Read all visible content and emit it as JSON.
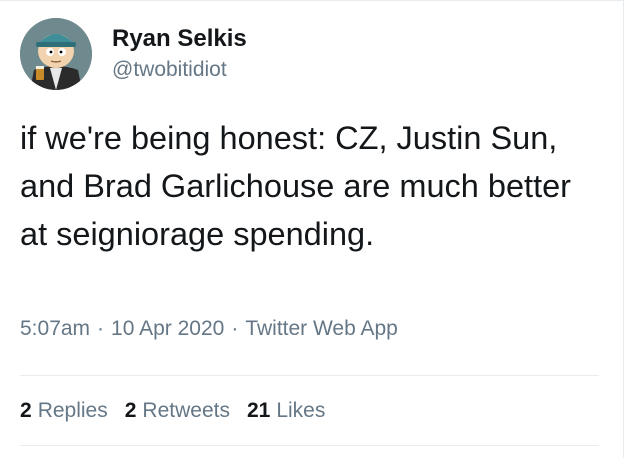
{
  "tweet": {
    "author_name": "Ryan Selkis",
    "author_handle": "@twobitidiot",
    "text": "if we're being honest: CZ, Justin Sun, and Brad Garlichouse are much better at seigniorage spending.",
    "time": "5:07am",
    "separator": "·",
    "date": "10 Apr 2020",
    "source": "Twitter Web App",
    "avatar_icon": "cartoon-avatar-icon"
  },
  "stats": {
    "replies_count": "2",
    "replies_label": "Replies",
    "retweets_count": "2",
    "retweets_label": "Retweets",
    "likes_count": "21",
    "likes_label": "Likes"
  },
  "colors": {
    "text_primary": "#14171a",
    "text_secondary": "#657786",
    "divider": "#e6ecf0"
  }
}
